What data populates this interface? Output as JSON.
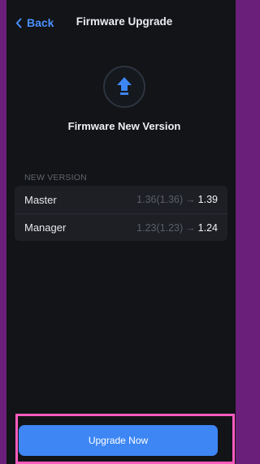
{
  "header": {
    "back_label": "Back",
    "title": "Firmware Upgrade"
  },
  "hero": {
    "icon": "upload-arrow-icon",
    "title": "Firmware New Version"
  },
  "versions": {
    "section_label": "NEW VERSION",
    "rows": [
      {
        "name": "Master",
        "current": "1.36(1.36)",
        "new": "1.39"
      },
      {
        "name": "Manager",
        "current": "1.23(1.23)",
        "new": "1.24"
      }
    ],
    "arrow": "→"
  },
  "action": {
    "button_label": "Upgrade Now"
  },
  "colors": {
    "accent": "#3d86f4",
    "background": "#131417",
    "card": "#1d1f24",
    "highlight_frame": "#ff5bbf",
    "outer_frame": "#6a1f7a"
  }
}
